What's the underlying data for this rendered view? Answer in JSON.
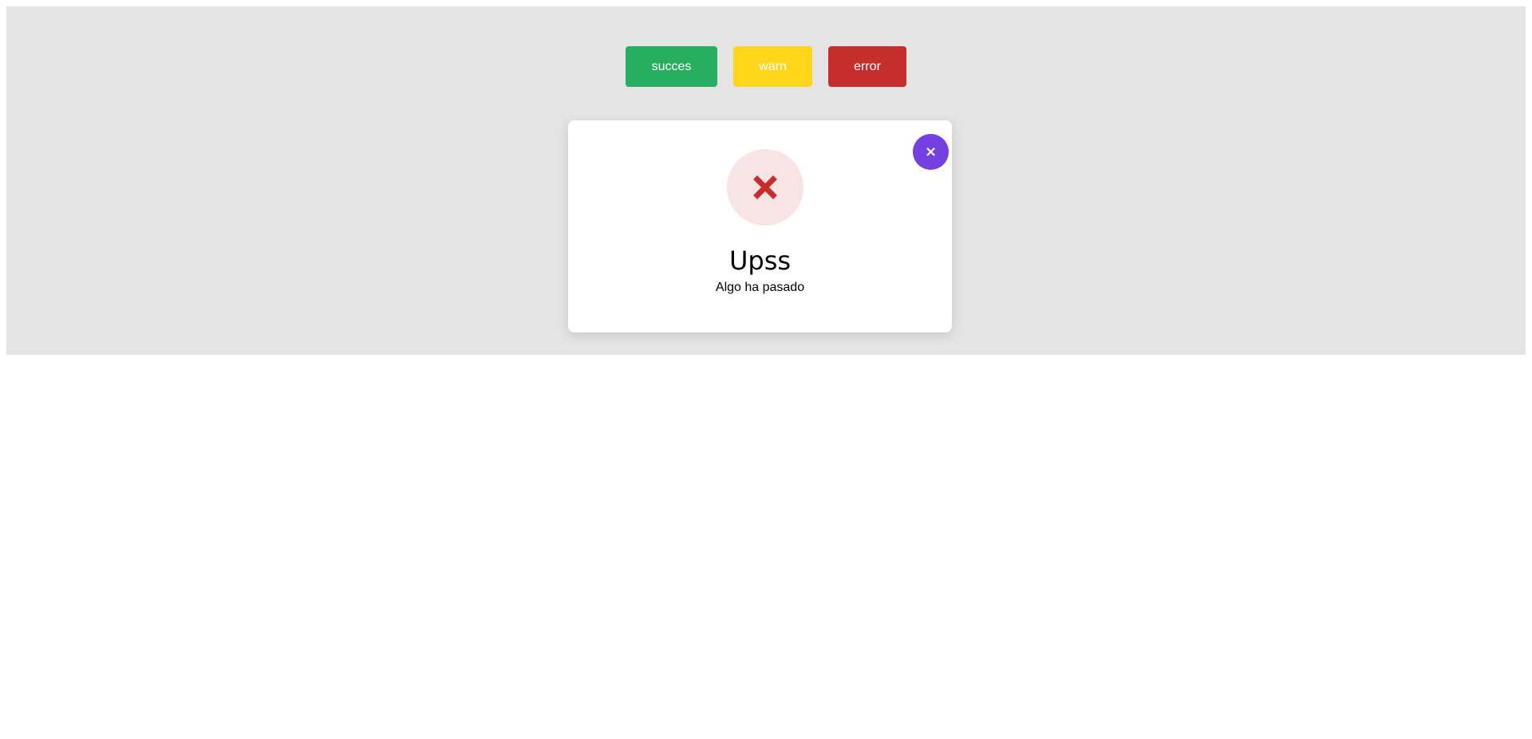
{
  "buttons": {
    "success_label": "succes",
    "warn_label": "warn",
    "error_label": "error"
  },
  "modal": {
    "close_label": "×",
    "icon": "error-x-icon",
    "title": "Upss",
    "message": "Algo ha pasado"
  },
  "colors": {
    "panel_background": "#e4e4e4",
    "success": "#27ae60",
    "warn": "#fed71a",
    "error": "#c62d2d",
    "close_button": "#7441e0",
    "error_icon_background": "#f7e5e4"
  }
}
